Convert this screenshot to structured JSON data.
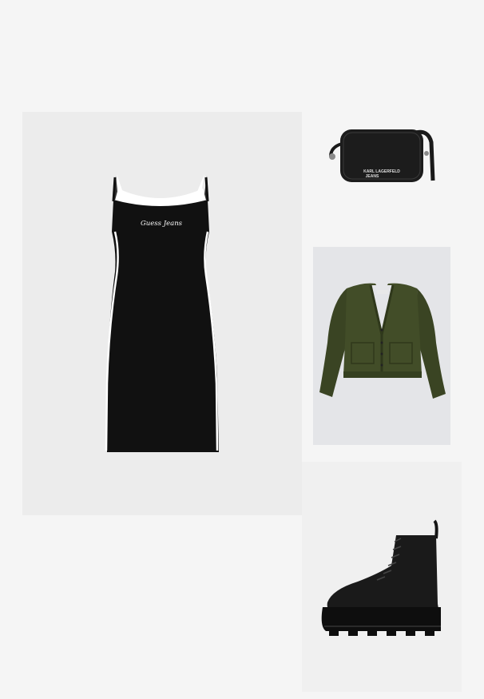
{
  "outfit": {
    "items": [
      {
        "id": "dress",
        "name": "dress",
        "print": "Guess Jeans",
        "color": "#111111",
        "trim_color": "#ffffff"
      },
      {
        "id": "bag",
        "name": "crossbody-bag",
        "print_line1": "KARL LAGERFELD",
        "print_line2": "JEANS",
        "color": "#1a1a1a"
      },
      {
        "id": "cardigan",
        "name": "cardigan",
        "color": "#3f4a26"
      },
      {
        "id": "boot",
        "name": "lace-up-boot",
        "color": "#151515"
      }
    ]
  }
}
